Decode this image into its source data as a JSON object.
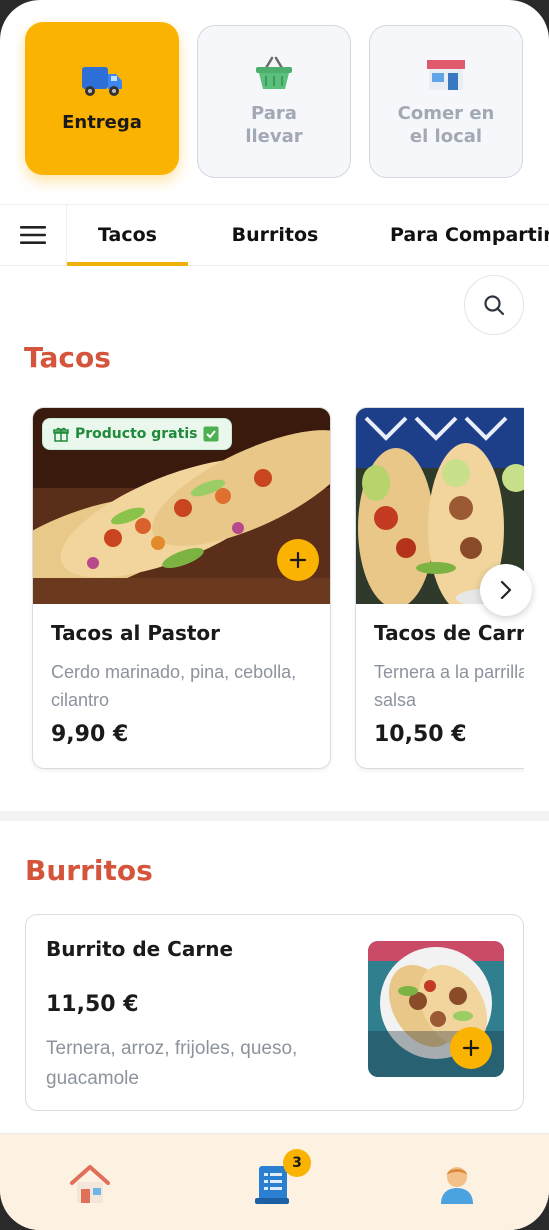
{
  "modes": [
    {
      "label": "Entrega",
      "icon": "delivery-truck-icon",
      "active": true
    },
    {
      "label": "Para\nllevar",
      "icon": "basket-icon",
      "active": false
    },
    {
      "label": "Comer en\nel local",
      "icon": "shop-icon",
      "active": false
    }
  ],
  "tabs": {
    "menu_icon": "hamburger-menu-icon",
    "items": [
      "Tacos",
      "Burritos",
      "Para Compartir"
    ],
    "active": "Tacos"
  },
  "search": {
    "icon": "search-icon"
  },
  "sections": {
    "tacos": {
      "title": "Tacos",
      "products": [
        {
          "name": "Tacos al Pastor",
          "description": "Cerdo marinado, pina, cebolla, cilantro",
          "price": "9,90 €",
          "badge": "Producto gratis"
        },
        {
          "name": "Tacos de Carne Asada",
          "description": "Ternera a la parrilla, guacamole, salsa",
          "price": "10,50 €"
        }
      ]
    },
    "burritos": {
      "title": "Burritos",
      "products": [
        {
          "name": "Burrito de Carne",
          "price": "11,50 €",
          "description": "Ternera, arroz, frijoles, queso, guacamole"
        }
      ]
    }
  },
  "bottom_nav": {
    "items": [
      "home-icon",
      "orders-receipt-icon",
      "profile-icon"
    ],
    "cart_count": "3"
  },
  "colors": {
    "accent": "#f9b300",
    "section_title": "#d4553b",
    "badge_green": "#1f8a3a",
    "nav_bg": "#fdf1e1"
  }
}
